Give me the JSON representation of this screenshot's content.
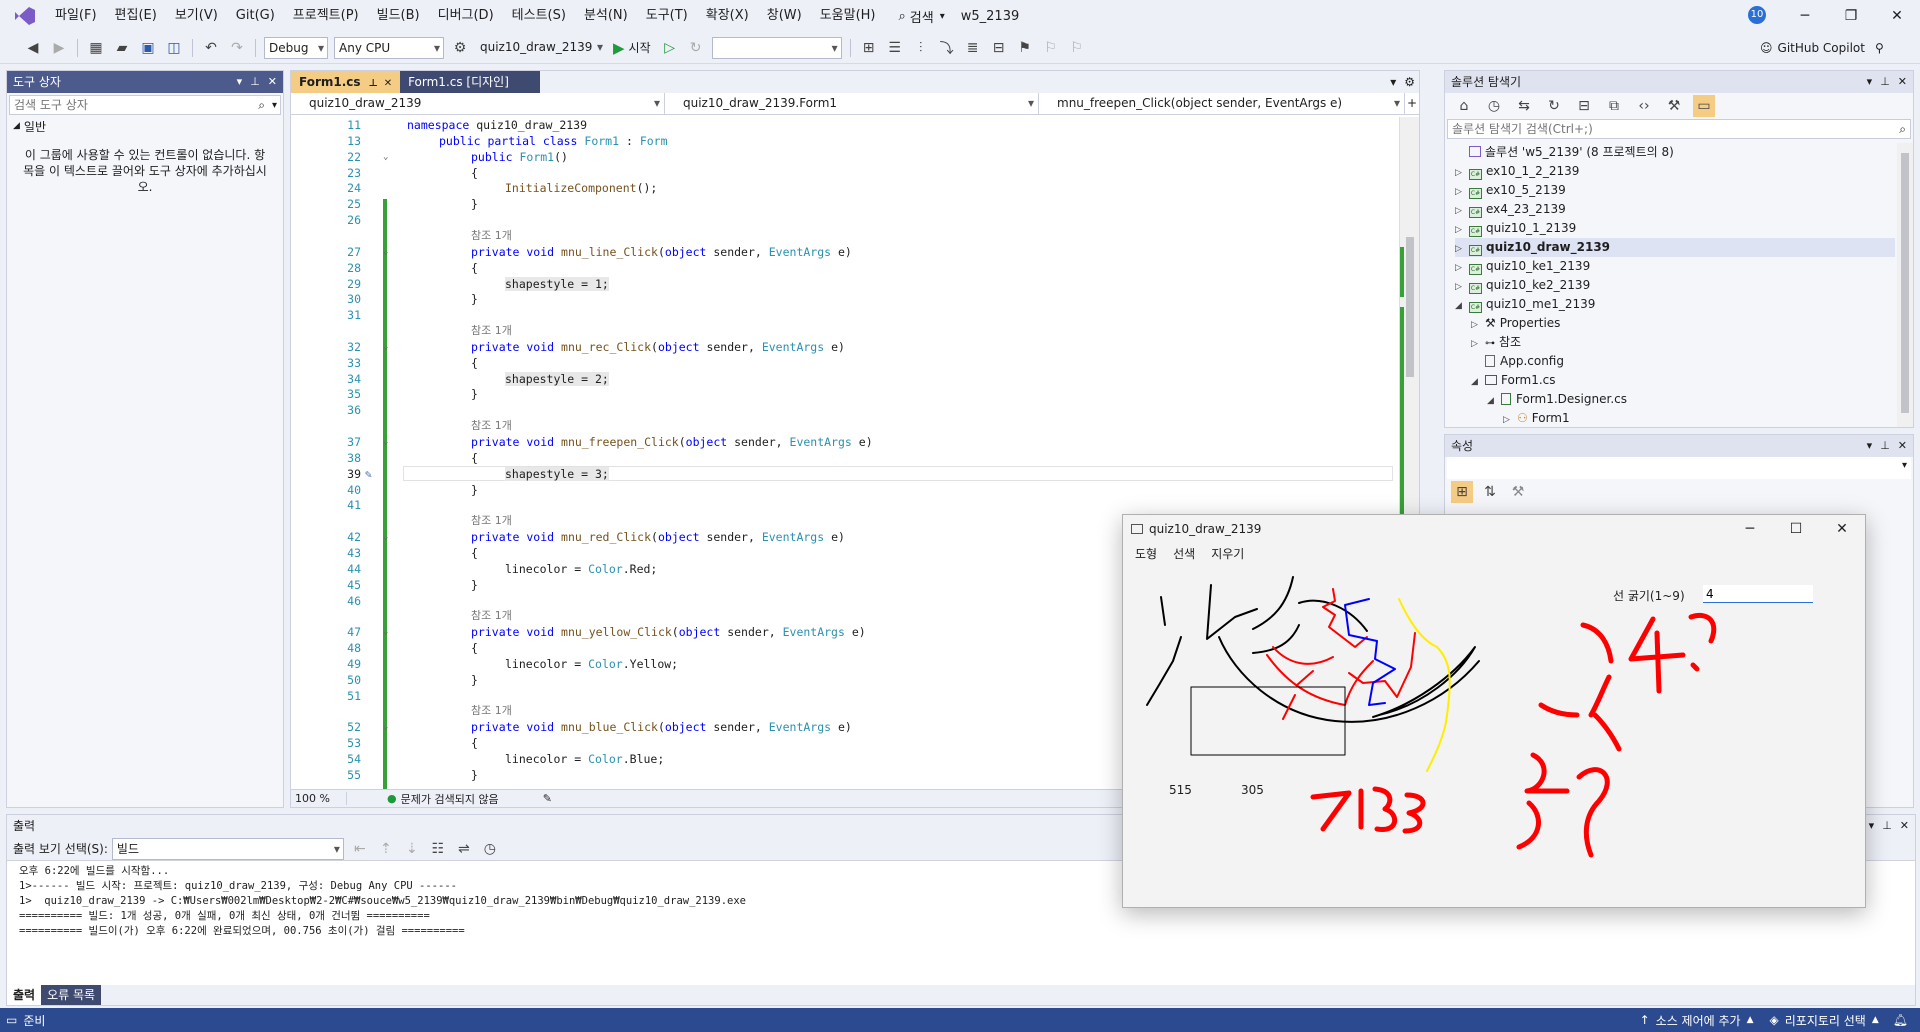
{
  "menu": {
    "items": [
      "파일(F)",
      "편집(E)",
      "보기(V)",
      "Git(G)",
      "프로젝트(P)",
      "빌드(B)",
      "디버그(D)",
      "테스트(S)",
      "분석(N)",
      "도구(T)",
      "확장(X)",
      "창(W)",
      "도움말(H)"
    ],
    "search_label": "검색",
    "solution_name": "w5_2139",
    "notif_count": "10"
  },
  "toolbar": {
    "config": "Debug",
    "platform": "Any CPU",
    "startup_project": "quiz10_draw_2139",
    "start_label": "시작",
    "copilot": "GitHub Copilot"
  },
  "toolbox": {
    "title": "도구 상자",
    "search_placeholder": "검색 도구 상자",
    "group": "일반",
    "empty_msg": "이 그룹에 사용할 수 있는 컨트롤이 없습니다. 항목을 이 텍스트로 끌어와 도구 상자에 추가하십시오."
  },
  "editor": {
    "tabs": [
      "Form1.cs",
      "Form1.cs [디자인]"
    ],
    "nav": [
      "quiz10_draw_2139",
      "quiz10_draw_2139.Form1",
      "mnu_freepen_Click(object sender, EventArgs e)"
    ],
    "zoom": "100 %",
    "issues": "문제가 검색되지 않음",
    "ref_label": "참조 1개",
    "lines": [
      {
        "n": "11",
        "parts": [
          [
            "kw",
            "namespace "
          ],
          [
            "nm",
            "quiz10_draw_2139"
          ]
        ],
        "indent": 0
      },
      {
        "n": "13",
        "parts": [
          [
            "kw",
            "public partial class "
          ],
          [
            "ty",
            "Form1"
          ],
          [
            "nm",
            " : "
          ],
          [
            "ty",
            "Form"
          ]
        ],
        "indent": 1
      },
      {
        "n": "22",
        "parts": [
          [
            "kw",
            "public "
          ],
          [
            "ty",
            "Form1"
          ],
          [
            "nm",
            "()"
          ]
        ],
        "indent": 2,
        "fold": true
      },
      {
        "n": "23",
        "parts": [
          [
            "nm",
            "{"
          ]
        ],
        "indent": 2
      },
      {
        "n": "24",
        "parts": [
          [
            "mn",
            "InitializeComponent"
          ],
          [
            "nm",
            "();"
          ]
        ],
        "indent": 3
      },
      {
        "n": "25",
        "parts": [
          [
            "nm",
            "}"
          ]
        ],
        "indent": 2
      },
      {
        "n": "26",
        "parts": [],
        "indent": 2
      },
      {
        "ref": true
      },
      {
        "n": "27",
        "parts": [
          [
            "kw",
            "private void "
          ],
          [
            "mn",
            "mnu_line_Click"
          ],
          [
            "nm",
            "("
          ],
          [
            "kw",
            "object "
          ],
          [
            "nm",
            "sender, "
          ],
          [
            "ty",
            "EventArgs "
          ],
          [
            "nm",
            "e)"
          ]
        ],
        "indent": 2,
        "fold": true
      },
      {
        "n": "28",
        "parts": [
          [
            "nm",
            "{"
          ]
        ],
        "indent": 2
      },
      {
        "n": "29",
        "parts": [
          [
            "nm",
            "shapestyle = 1;"
          ]
        ],
        "indent": 3,
        "hl": true
      },
      {
        "n": "30",
        "parts": [
          [
            "nm",
            "}"
          ]
        ],
        "indent": 2
      },
      {
        "n": "31",
        "parts": [],
        "indent": 2
      },
      {
        "ref": true
      },
      {
        "n": "32",
        "parts": [
          [
            "kw",
            "private void "
          ],
          [
            "mn",
            "mnu_rec_Click"
          ],
          [
            "nm",
            "("
          ],
          [
            "kw",
            "object "
          ],
          [
            "nm",
            "sender, "
          ],
          [
            "ty",
            "EventArgs "
          ],
          [
            "nm",
            "e)"
          ]
        ],
        "indent": 2,
        "fold": true
      },
      {
        "n": "33",
        "parts": [
          [
            "nm",
            "{"
          ]
        ],
        "indent": 2
      },
      {
        "n": "34",
        "parts": [
          [
            "nm",
            "shapestyle = 2;"
          ]
        ],
        "indent": 3,
        "hl": true
      },
      {
        "n": "35",
        "parts": [
          [
            "nm",
            "}"
          ]
        ],
        "indent": 2
      },
      {
        "n": "36",
        "parts": [],
        "indent": 2
      },
      {
        "ref": true
      },
      {
        "n": "37",
        "parts": [
          [
            "kw",
            "private void "
          ],
          [
            "mn",
            "mnu_freepen_Click"
          ],
          [
            "nm",
            "("
          ],
          [
            "kw",
            "object "
          ],
          [
            "nm",
            "sender, "
          ],
          [
            "ty",
            "EventArgs "
          ],
          [
            "nm",
            "e)"
          ]
        ],
        "indent": 2,
        "fold": true
      },
      {
        "n": "38",
        "parts": [
          [
            "nm",
            "{"
          ]
        ],
        "indent": 2
      },
      {
        "n": "39",
        "parts": [
          [
            "nm",
            "shapestyle = 3;"
          ]
        ],
        "indent": 3,
        "hl": true,
        "current": true
      },
      {
        "n": "40",
        "parts": [
          [
            "nm",
            "}"
          ]
        ],
        "indent": 2
      },
      {
        "n": "41",
        "parts": [],
        "indent": 2
      },
      {
        "ref": true
      },
      {
        "n": "42",
        "parts": [
          [
            "kw",
            "private void "
          ],
          [
            "mn",
            "mnu_red_Click"
          ],
          [
            "nm",
            "("
          ],
          [
            "kw",
            "object "
          ],
          [
            "nm",
            "sender, "
          ],
          [
            "ty",
            "EventArgs "
          ],
          [
            "nm",
            "e)"
          ]
        ],
        "indent": 2,
        "fold": true
      },
      {
        "n": "43",
        "parts": [
          [
            "nm",
            "{"
          ]
        ],
        "indent": 2
      },
      {
        "n": "44",
        "parts": [
          [
            "nm",
            "linecolor = "
          ],
          [
            "ty",
            "Color"
          ],
          [
            "nm",
            ".Red;"
          ]
        ],
        "indent": 3
      },
      {
        "n": "45",
        "parts": [
          [
            "nm",
            "}"
          ]
        ],
        "indent": 2
      },
      {
        "n": "46",
        "parts": [],
        "indent": 2
      },
      {
        "ref": true
      },
      {
        "n": "47",
        "parts": [
          [
            "kw",
            "private void "
          ],
          [
            "mn",
            "mnu_yellow_Click"
          ],
          [
            "nm",
            "("
          ],
          [
            "kw",
            "object "
          ],
          [
            "nm",
            "sender, "
          ],
          [
            "ty",
            "EventArgs "
          ],
          [
            "nm",
            "e)"
          ]
        ],
        "indent": 2,
        "fold": true
      },
      {
        "n": "48",
        "parts": [
          [
            "nm",
            "{"
          ]
        ],
        "indent": 2
      },
      {
        "n": "49",
        "parts": [
          [
            "nm",
            "linecolor = "
          ],
          [
            "ty",
            "Color"
          ],
          [
            "nm",
            ".Yellow;"
          ]
        ],
        "indent": 3
      },
      {
        "n": "50",
        "parts": [
          [
            "nm",
            "}"
          ]
        ],
        "indent": 2
      },
      {
        "n": "51",
        "parts": [],
        "indent": 2
      },
      {
        "ref": true
      },
      {
        "n": "52",
        "parts": [
          [
            "kw",
            "private void "
          ],
          [
            "mn",
            "mnu_blue_Click"
          ],
          [
            "nm",
            "("
          ],
          [
            "kw",
            "object "
          ],
          [
            "nm",
            "sender, "
          ],
          [
            "ty",
            "EventArgs "
          ],
          [
            "nm",
            "e)"
          ]
        ],
        "indent": 2,
        "fold": true
      },
      {
        "n": "53",
        "parts": [
          [
            "nm",
            "{"
          ]
        ],
        "indent": 2
      },
      {
        "n": "54",
        "parts": [
          [
            "nm",
            "linecolor = "
          ],
          [
            "ty",
            "Color"
          ],
          [
            "nm",
            ".Blue;"
          ]
        ],
        "indent": 3
      },
      {
        "n": "55",
        "parts": [
          [
            "nm",
            "}"
          ]
        ],
        "indent": 2
      }
    ]
  },
  "output": {
    "title": "출력",
    "source_label": "출력 보기 선택(S):",
    "source_value": "빌드",
    "lines": [
      "오후 6:22에 빌드를 시작함...",
      "1>------ 빌드 시작: 프로젝트: quiz10_draw_2139, 구성: Debug Any CPU ------",
      "1>  quiz10_draw_2139 -> C:₩Users₩002lm₩Desktop₩2-2₩C#₩souce₩w5_2139₩quiz10_draw_2139₩bin₩Debug₩quiz10_draw_2139.exe",
      "========== 빌드: 1개 성공, 0개 실패, 0개 최신 상태, 0개 건너뜀 ==========",
      "========== 빌드이(가) 오후 6:22에 완료되었으며, 00.756 초이(가) 걸림 =========="
    ],
    "tabs": [
      "출력",
      "오류 목록"
    ]
  },
  "solution": {
    "title": "솔루션 탐색기",
    "search_placeholder": "솔루션 탐색기 검색(Ctrl+;)",
    "root": "솔루션 'w5_2139' (8 프로젝트의 8)",
    "projects": [
      "ex10_1_2_2139",
      "ex10_5_2139",
      "ex4_23_2139",
      "quiz10_1_2139",
      "quiz10_draw_2139",
      "quiz10_ke1_2139",
      "quiz10_ke2_2139",
      "quiz10_me1_2139"
    ],
    "bold_project": "quiz10_draw_2139",
    "children": [
      "Properties",
      "참조",
      "App.config",
      "Form1.cs",
      "Form1.Designer.cs",
      "Form1"
    ]
  },
  "properties": {
    "title": "속성"
  },
  "app": {
    "title": "quiz10_draw_2139",
    "menu": [
      "도형",
      "선색",
      "지우기"
    ],
    "thickness_label": "선 굵기(1~9)",
    "thickness_value": "4",
    "coord_x": "515",
    "coord_y": "305"
  },
  "status": {
    "ready": "준비",
    "source_control": "소스 제어에 추가",
    "repo": "리포지토리 선택"
  }
}
